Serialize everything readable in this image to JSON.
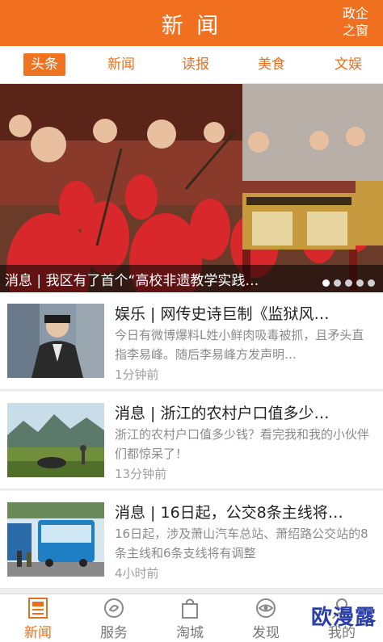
{
  "header": {
    "title": "新 闻",
    "corner_line1": "政企",
    "corner_line2": "之窗"
  },
  "tabs": [
    {
      "label": "头条",
      "active": true
    },
    {
      "label": "新闻"
    },
    {
      "label": "读报"
    },
    {
      "label": "美食"
    },
    {
      "label": "文娱"
    }
  ],
  "hero": {
    "caption": "消息 | 我区有了首个“高校非遗教学实践…",
    "slide_count": 5,
    "active_slide": 1
  },
  "news": [
    {
      "title": "娱乐 | 网传史诗巨制《监狱风…",
      "summary": "今日有微博爆料L姓小鲜肉吸毒被抓，且矛头直指李易峰。随后李易峰方发声明…",
      "time": "1分钟前",
      "thumb_icon": "person-photo"
    },
    {
      "title": "消息 | 浙江的农村户口值多少…",
      "summary": "浙江的农村户口值多少钱？看完我和我的小伙伴们都惊呆了！",
      "time": "13分钟前",
      "thumb_icon": "farm-photo"
    },
    {
      "title": "消息 | 16日起，公交8条主线将…",
      "summary": "16日起，涉及萧山汽车总站、萧绍路公交站的8条主线和6条支线将有调整",
      "time": "4小时前",
      "thumb_icon": "bus-photo"
    }
  ],
  "bottom_nav": [
    {
      "label": "新闻",
      "icon": "newspaper-icon",
      "active": true
    },
    {
      "label": "服务",
      "icon": "service-icon"
    },
    {
      "label": "淘城",
      "icon": "shopping-bag-icon"
    },
    {
      "label": "发现",
      "icon": "eye-icon"
    },
    {
      "label": "我的",
      "icon": "user-icon"
    }
  ],
  "watermark": "欧漫露",
  "colors": {
    "accent": "#f07020",
    "text": "#222222",
    "muted": "#8a8a8a"
  }
}
